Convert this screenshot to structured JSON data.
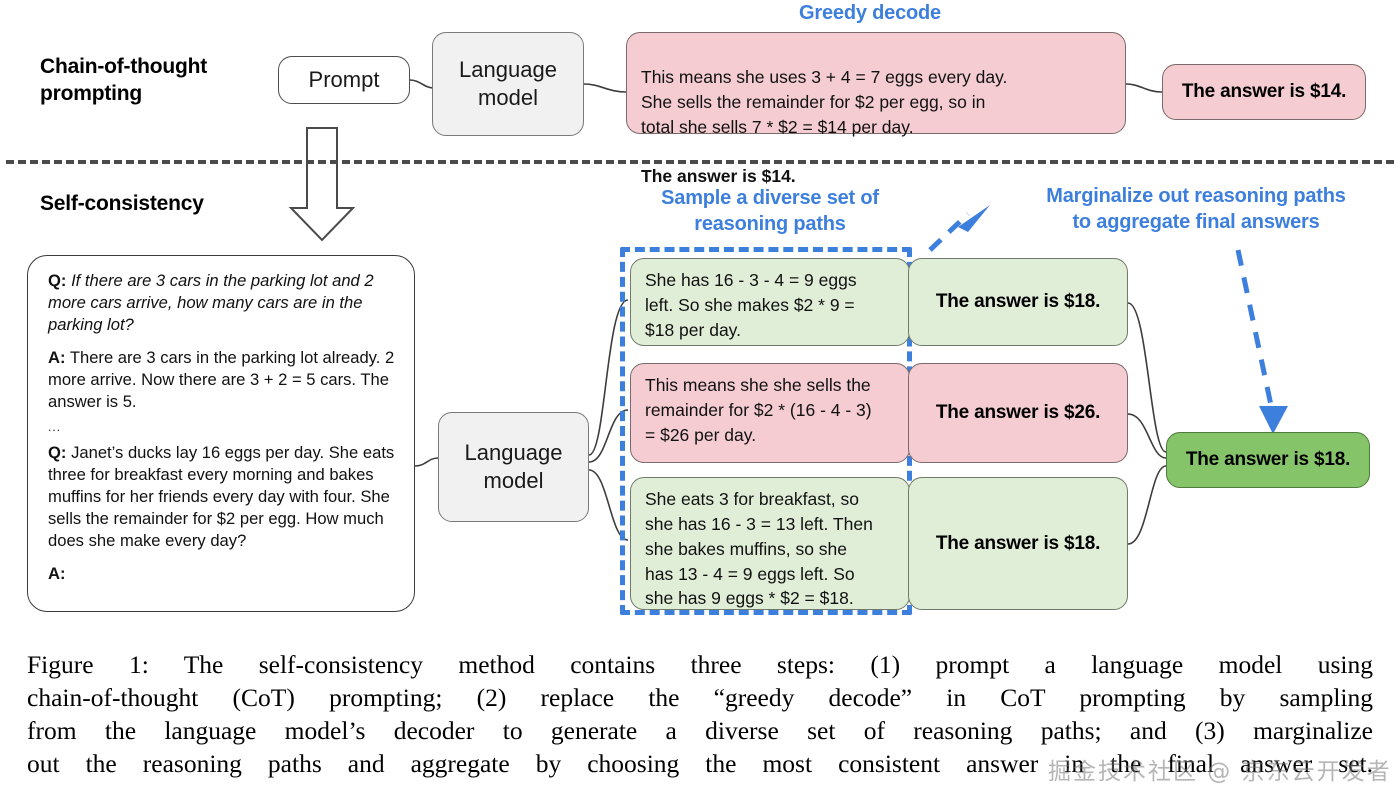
{
  "colors": {
    "accent_blue": "#3d7fdd",
    "pink_fill": "#f4ccd1",
    "light_green_fill": "#e0eed8",
    "dark_green_fill": "#86c46a",
    "gray_fill": "#f1f1f1",
    "divider_gray": "#4a4a4a"
  },
  "sections": {
    "cot": {
      "label": "Chain-of-thought\nprompting"
    },
    "self_consistency": {
      "label": "Self-consistency"
    }
  },
  "cot_row": {
    "prompt_box": {
      "label": "Prompt"
    },
    "language_model_box": {
      "label": "Language\nmodel"
    },
    "greedy_caption": "Greedy decode",
    "output_box": {
      "body": "This means she uses 3 + 4 = 7 eggs every day.\nShe sells the remainder for $2 per egg, so in\ntotal she sells 7 * $2 = $14 per day.",
      "answer_line": "The answer is $14."
    },
    "final_answer_box": {
      "label": "The answer is $14."
    }
  },
  "sc_row": {
    "prompt_card": {
      "q1_label": "Q:",
      "q1_text": "If there are 3 cars in the parking lot and 2 more cars arrive, how many cars are in the parking lot?",
      "a1_label": "A:",
      "a1_text": "There are 3 cars in the parking lot already. 2 more arrive. Now there are 3 + 2 = 5 cars. The answer is 5.",
      "ellipsis": "...",
      "q2_label": "Q:",
      "q2_text": "Janet’s ducks lay 16 eggs per day. She eats three for breakfast every morning and bakes muffins for her friends every day with four. She sells the remainder for $2 per egg. How much does she make every day?",
      "a2_label": "A:"
    },
    "language_model_box": {
      "label": "Language\nmodel"
    },
    "sample_caption": "Sample a diverse set of\nreasoning paths",
    "marginalize_caption": "Marginalize out reasoning paths\nto aggregate final answers",
    "paths": [
      {
        "reasoning": "She has 16 - 3 - 4 = 9 eggs\nleft. So she makes $2 * 9 =\n$18 per day.",
        "answer": "The answer is $18.",
        "color": "green"
      },
      {
        "reasoning": "This means she she sells the\nremainder for $2 * (16 - 4 - 3)\n= $26 per day.",
        "answer": "The answer is $26.",
        "color": "pink"
      },
      {
        "reasoning": "She eats 3 for breakfast, so\nshe has 16 - 3 = 13 left. Then\nshe bakes muffins, so she\nhas 13 - 4 = 9 eggs left. So\nshe has 9 eggs * $2 = $18.",
        "answer": "The answer is $18.",
        "color": "green"
      }
    ],
    "final_answer_box": {
      "label": "The answer is $18."
    }
  },
  "caption": {
    "lines": "Figure 1: The self-consistency method contains three steps: (1) prompt a language model using\nchain-of-thought (CoT) prompting; (2) replace the “greedy decode” in CoT prompting by sampling\nfrom the language model’s decoder to generate a diverse set of reasoning paths; and (3) marginalize\nout the reasoning paths and aggregate by choosing the most consistent answer in the final answer set."
  },
  "watermark": {
    "text": "掘金技术社区 @ 京东云开发者"
  }
}
